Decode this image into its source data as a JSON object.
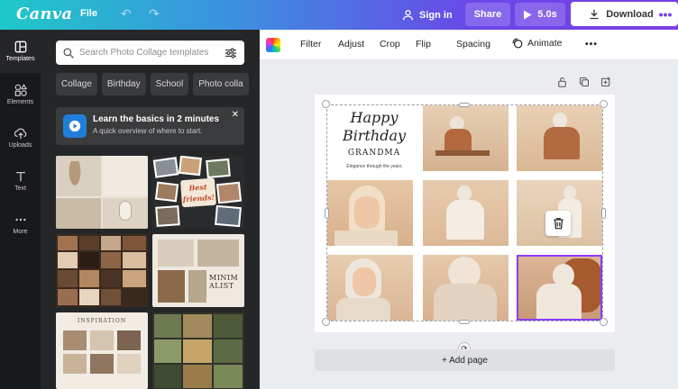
{
  "topbar": {
    "logo": "Canva",
    "file": "File",
    "signin": "Sign in",
    "share": "Share",
    "duration": "5.0s",
    "download": "Download",
    "more": "•••"
  },
  "rail": {
    "items": [
      {
        "label": "Templates",
        "icon": "templates-icon"
      },
      {
        "label": "Elements",
        "icon": "elements-icon"
      },
      {
        "label": "Uploads",
        "icon": "upload-icon"
      },
      {
        "label": "Text",
        "icon": "text-icon"
      },
      {
        "label": "More",
        "icon": "more-icon"
      }
    ]
  },
  "panel": {
    "search_placeholder": "Search Photo Collage templates",
    "chips": [
      "Collage",
      "Birthday",
      "School",
      "Photo colla"
    ],
    "promo": {
      "title": "Learn the basics in 2 minutes",
      "subtitle": "A quick overview of where to start."
    },
    "template_texts": {
      "best_friends": "Best friends!",
      "minimalist": "MINIM ALIST",
      "inspiration": "INSPIRATION"
    }
  },
  "toolbar": {
    "filter": "Filter",
    "adjust": "Adjust",
    "crop": "Crop",
    "flip": "Flip",
    "spacing": "Spacing",
    "animate": "Animate",
    "more": "•••"
  },
  "canvas": {
    "title_line1": "Happy",
    "title_line2": "Birthday",
    "title_line3": "GRANDMA",
    "tagline": "Elegance through the years",
    "add_page": "+ Add page"
  },
  "colors": {
    "accent": "#7b3fe6",
    "selection": "#8b3dff",
    "panel_bg": "#252627",
    "rail_bg": "#18191b",
    "workspace_bg": "#ebecf0"
  }
}
